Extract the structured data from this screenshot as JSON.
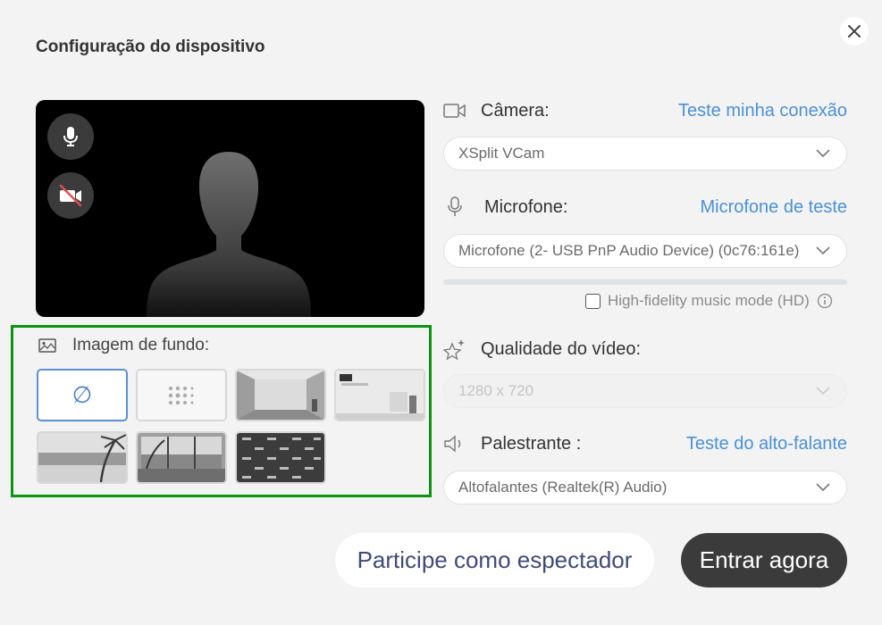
{
  "dialog": {
    "title": "Configuração do dispositivo"
  },
  "background": {
    "label": "Imagem de fundo:",
    "none_symbol": "∅",
    "selected_index": 0
  },
  "camera": {
    "label": "Câmera:",
    "link": "Teste minha conexão",
    "selected": "XSplit VCam"
  },
  "microphone": {
    "label": "Microfone:",
    "link": "Microfone de teste",
    "selected": "Microfone (2- USB PnP Audio Device) (0c76:161e)",
    "level": 0,
    "hd_mode_label": "High-fidelity music mode (HD)",
    "hd_mode_checked": false
  },
  "video_quality": {
    "label": "Qualidade do vídeo:",
    "selected": "1280 x 720"
  },
  "speaker": {
    "label": "Palestrante :",
    "link": "Teste do alto-falante",
    "selected": "Altofalantes (Realtek(R) Audio)"
  },
  "actions": {
    "spectator": "Participe como espectador",
    "join": "Entrar agora"
  },
  "colors": {
    "accent_link": "#4a90d9",
    "selection_border": "#0a9412",
    "dark_button": "#3b3b3b"
  }
}
